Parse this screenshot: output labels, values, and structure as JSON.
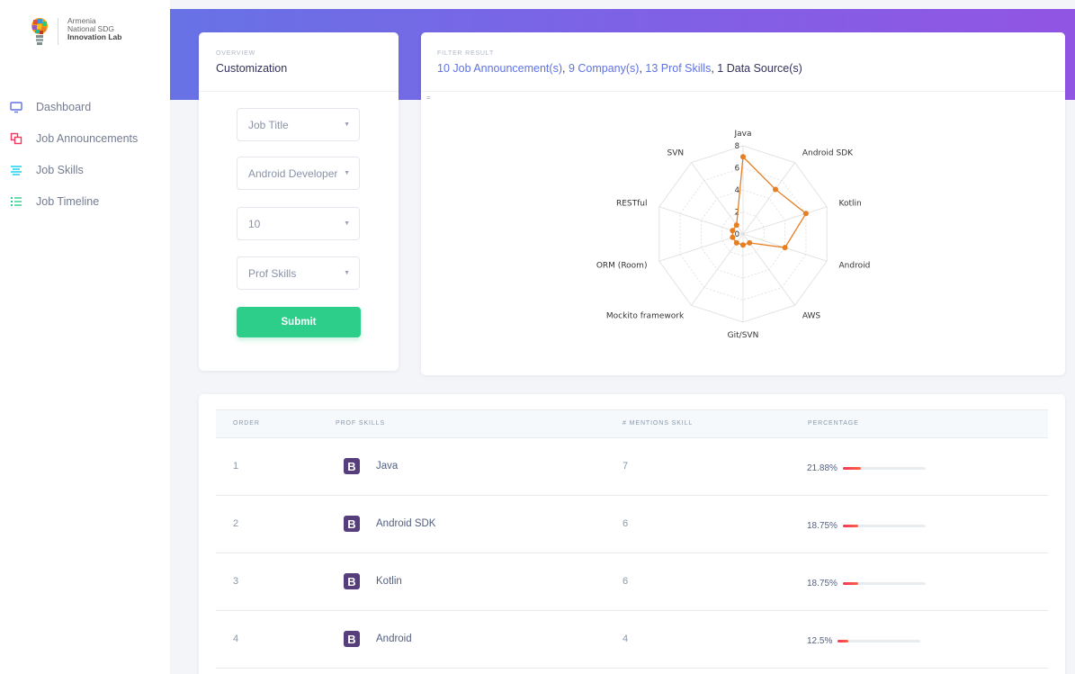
{
  "brand": {
    "line1": "Armenia",
    "line2": "National SDG",
    "line3": "Innovation Lab"
  },
  "nav": [
    {
      "label": "Dashboard",
      "icon": "monitor-icon",
      "color": "#5e72e4"
    },
    {
      "label": "Job Announcements",
      "icon": "copy-icon",
      "color": "#f5365c"
    },
    {
      "label": "Job Skills",
      "icon": "align-icon",
      "color": "#11cdef"
    },
    {
      "label": "Job Timeline",
      "icon": "list-icon",
      "color": "#2dce89"
    }
  ],
  "customization": {
    "subtitle": "OVERVIEW",
    "title": "Customization",
    "selects": [
      "Job Title",
      "Android Developer",
      "10",
      "Prof Skills"
    ],
    "submit": "Submit"
  },
  "filter": {
    "subtitle": "FILTER RESULT",
    "jobs": "10 Job Announcement(s)",
    "companies": "9 Company(s)",
    "skills": "13 Prof Skills",
    "sources": "1 Data Source(s)",
    "sep": ", ",
    "tiny": "="
  },
  "chart_data": {
    "type": "radar",
    "categories": [
      "Java",
      "Android SDK",
      "Kotlin",
      "Android",
      "AWS",
      "Git/SVN",
      "Mockito framework",
      "ORM (Room)",
      "RESTful",
      "SVN"
    ],
    "values": [
      7,
      5,
      6,
      4,
      1,
      1,
      1,
      1,
      1,
      1
    ],
    "rlim": [
      0,
      8
    ],
    "ticks": [
      "0",
      "2",
      "4",
      "6",
      "8"
    ],
    "color": "#e67e22"
  },
  "table": {
    "headers": [
      "ORDER",
      "PROF SKILLS",
      "# MENTIONS SKILL",
      "PERCENTAGE"
    ],
    "rows": [
      {
        "order": "1",
        "skill": "Java",
        "mentions": "7",
        "percentage": "21.88%",
        "fraction": 0.2188
      },
      {
        "order": "2",
        "skill": "Android SDK",
        "mentions": "6",
        "percentage": "18.75%",
        "fraction": 0.1875
      },
      {
        "order": "3",
        "skill": "Kotlin",
        "mentions": "6",
        "percentage": "18.75%",
        "fraction": 0.1875
      },
      {
        "order": "4",
        "skill": "Android",
        "mentions": "4",
        "percentage": "12.5%",
        "fraction": 0.125
      }
    ],
    "badge": "B"
  }
}
